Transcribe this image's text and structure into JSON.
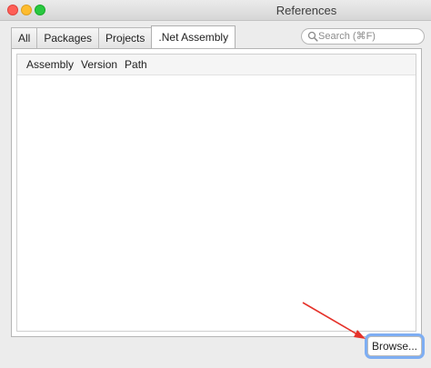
{
  "window": {
    "title": "References"
  },
  "tabs": [
    {
      "label": "All"
    },
    {
      "label": "Packages"
    },
    {
      "label": "Projects"
    },
    {
      "label": ".Net Assembly",
      "active": true
    }
  ],
  "search": {
    "placeholder": "Search (⌘F)",
    "value": ""
  },
  "list": {
    "columns": [
      "Assembly",
      "Version",
      "Path"
    ],
    "rows": []
  },
  "footer": {
    "browse_label": "Browse..."
  },
  "colors": {
    "accent": "#7eaef3",
    "annotation_arrow": "#e5322a"
  },
  "icons": {
    "search": "search-icon",
    "annotation": "red-arrow-icon"
  }
}
